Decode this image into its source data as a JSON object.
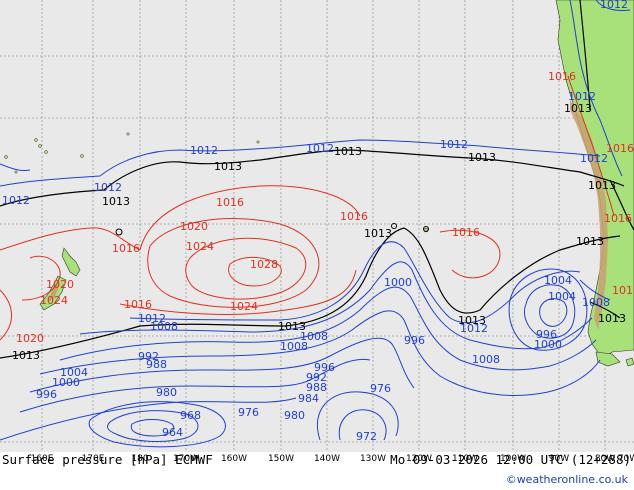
{
  "title": "Surface pressure [hPa] ECMWF",
  "valid_time": "Mo 09-03-2026 12:00 UTC (12+288)",
  "credit": "©weatheronline.co.uk",
  "colors": {
    "ocean": "#e9e9e9",
    "land": "#a8e07a",
    "mountains": "#c8a070",
    "grid": "#9a9a9a",
    "isobar_low": "#2040d0",
    "isobar_high": "#e03020",
    "isobar_standard": "#000000",
    "credit": "#1a3fb0"
  },
  "lon_ticks": [
    "160E",
    "170E",
    "180",
    "170W",
    "160W",
    "150W",
    "140W",
    "130W",
    "120W",
    "110W",
    "100W",
    "90W",
    "80W",
    "70W"
  ],
  "isobar_labels": {
    "high": [
      "1016",
      "1016",
      "1016",
      "1016",
      "1016",
      "1016",
      "1016",
      "1016",
      "1016",
      "1020",
      "1020",
      "1020",
      "1024",
      "1024",
      "1024",
      "1028"
    ],
    "standard": [
      "1013",
      "1013",
      "1013",
      "1013",
      "1013",
      "1013",
      "1013",
      "1013",
      "1013",
      "1013",
      "1013",
      "1013"
    ],
    "low": [
      "1012",
      "1012",
      "1012",
      "1012",
      "1012",
      "1012",
      "1012",
      "1012",
      "1012",
      "1012",
      "1008",
      "1008",
      "1008",
      "1008",
      "1008",
      "1004",
      "1004",
      "1004",
      "1000",
      "1000",
      "1000",
      "996",
      "996",
      "996",
      "996",
      "992",
      "992",
      "988",
      "988",
      "984",
      "980",
      "980",
      "976",
      "976",
      "972",
      "968",
      "964",
      "1012"
    ]
  }
}
